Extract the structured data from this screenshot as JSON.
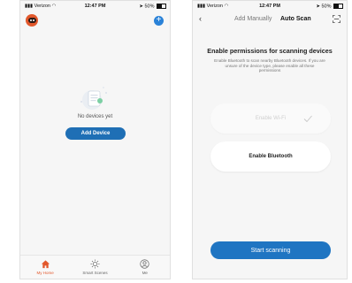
{
  "left_screen": {
    "status": {
      "carrier": "Verizon",
      "time": "12:47 PM",
      "battery": "50%"
    },
    "header": {
      "avatar_icon": "robot-icon",
      "add_icon": "plus-icon"
    },
    "empty_state": {
      "message": "No devices yet",
      "button_label": "Add Device"
    },
    "tab_bar": [
      {
        "label": "My Home",
        "icon": "home-icon",
        "active": true
      },
      {
        "label": "Smart Scenes",
        "icon": "sun-icon",
        "active": false
      },
      {
        "label": "Me",
        "icon": "user-icon",
        "active": false
      }
    ]
  },
  "right_screen": {
    "status": {
      "carrier": "Verizon",
      "time": "12:47 PM",
      "battery": "50%"
    },
    "nav": {
      "back_icon": "chevron-left-icon",
      "tab_manual": "Add Manually",
      "tab_auto": "Auto Scan",
      "scan_icon": "scan-frame-icon"
    },
    "title": "Enable permissions for scanning devices",
    "description": "Enable Bluetooth to scan nearby Bluetooth devices. If you are unsure of the device type, please enable all these permissions",
    "permissions": {
      "wifi": {
        "label": "Enable Wi-Fi",
        "enabled": true
      },
      "bluetooth": {
        "label": "Enable Bluetooth",
        "enabled": false
      }
    },
    "start_button": "Start scanning"
  },
  "colors": {
    "accent_blue": "#1f6fb5",
    "active_tab": "#e2582c",
    "background": "#f6f6f6"
  }
}
